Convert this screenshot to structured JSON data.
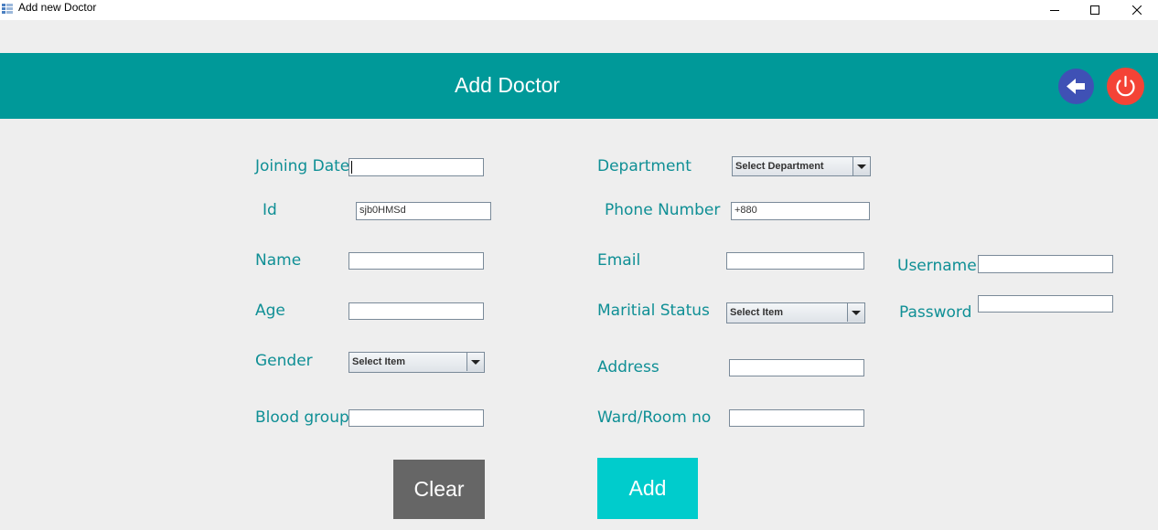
{
  "window": {
    "title": "Add new Doctor"
  },
  "header": {
    "title": "Add Doctor",
    "accent": "#009999"
  },
  "icons": {
    "back": "arrow-left-icon",
    "power": "power-icon"
  },
  "form": {
    "joining_date": {
      "label": "Joining Date",
      "value": ""
    },
    "id": {
      "label": "Id",
      "value": "sjb0HMSd"
    },
    "name": {
      "label": "Name",
      "value": ""
    },
    "age": {
      "label": "Age",
      "value": ""
    },
    "gender": {
      "label": "Gender",
      "selected": "Select Item"
    },
    "blood_group": {
      "label": "Blood group",
      "value": ""
    },
    "department": {
      "label": "Department",
      "selected": "Select Department"
    },
    "phone": {
      "label": "Phone Number",
      "value": "+880"
    },
    "email": {
      "label": "Email",
      "value": ""
    },
    "marital_status": {
      "label": "Maritial Status",
      "selected": "Select Item"
    },
    "address": {
      "label": "Address",
      "value": ""
    },
    "ward_room": {
      "label": "Ward/Room no",
      "value": ""
    },
    "username": {
      "label": "Username",
      "value": ""
    },
    "password": {
      "label": "Password",
      "value": ""
    }
  },
  "buttons": {
    "clear": "Clear",
    "add": "Add"
  },
  "colors": {
    "label": "#0f8f95",
    "clear_bg": "#666666",
    "add_bg": "#00cccc",
    "back_bg": "#3f51b5",
    "power_bg": "#f44336"
  }
}
